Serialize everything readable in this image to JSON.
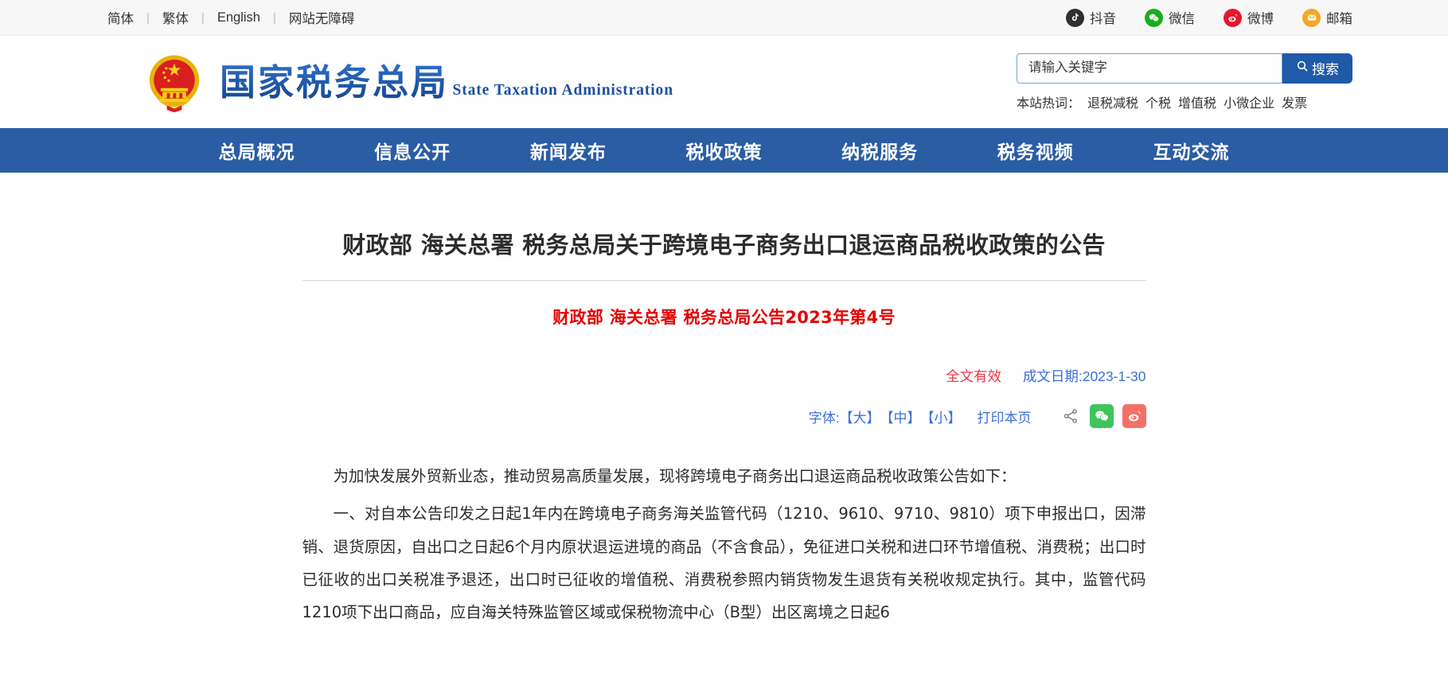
{
  "topbar": {
    "languages": [
      {
        "label": "简体",
        "name": "lang-simplified"
      },
      {
        "label": "繁体",
        "name": "lang-traditional"
      },
      {
        "label": "English",
        "name": "lang-english"
      },
      {
        "label": "网站无障碍",
        "name": "accessibility"
      }
    ],
    "separator": "|",
    "social": [
      {
        "label": "抖音",
        "icon": "douyin-icon",
        "color": "#2f2f2f"
      },
      {
        "label": "微信",
        "icon": "wechat-icon",
        "color": "#1aad19"
      },
      {
        "label": "微博",
        "icon": "weibo-icon",
        "color": "#e6162d"
      },
      {
        "label": "邮箱",
        "icon": "mail-icon",
        "color": "#f5a623"
      }
    ]
  },
  "header": {
    "emblem_alt": "national-emblem",
    "brand_cn": "国家税务总局",
    "brand_en": "State Taxation Administration",
    "search": {
      "placeholder": "请输入关键字",
      "value": "",
      "button_label": "搜索",
      "button_icon": "search-icon"
    },
    "hotwords": {
      "label": "本站热词：",
      "items": [
        "退税减税",
        "个税",
        "增值税",
        "小微企业",
        "发票"
      ]
    }
  },
  "nav": {
    "items": [
      "总局概况",
      "信息公开",
      "新闻发布",
      "税收政策",
      "纳税服务",
      "税务视频",
      "互动交流"
    ]
  },
  "article": {
    "title": "财政部 海关总署 税务总局关于跨境电子商务出口退运商品税收政策的公告",
    "subtitle": "财政部 海关总署 税务总局公告2023年第4号",
    "validity": "全文有效",
    "date": "成文日期:2023-1-30",
    "tools": {
      "font_label": "字体:",
      "font_large": "【大】",
      "font_medium": "【中】",
      "font_small": "【小】",
      "print": "打印本页",
      "share_icon": "share-nodes-icon",
      "wechat_icon": "wechat-share-icon",
      "weibo_icon": "weibo-share-icon"
    },
    "paragraphs": [
      "为加快发展外贸新业态，推动贸易高质量发展，现将跨境电子商务出口退运商品税收政策公告如下：",
      "一、对自本公告印发之日起1年内在跨境电子商务海关监管代码（1210、9610、9710、9810）项下申报出口，因滞销、退货原因，自出口之日起6个月内原状退运进境的商品（不含食品），免征进口关税和进口环节增值税、消费税；出口时已征收的出口关税准予退还，出口时已征收的增值税、消费税参照内销货物发生退货有关税收规定执行。其中，监管代码1210项下出口商品，应自海关特殊监管区域或保税物流中心（B型）出区离境之日起6"
    ]
  },
  "colors": {
    "nav_blue": "#2b5da4",
    "brand_blue": "#1b4fa0",
    "accent_red": "#e30000",
    "link_blue": "#3c6fd4",
    "valid_red": "#f5333f"
  }
}
